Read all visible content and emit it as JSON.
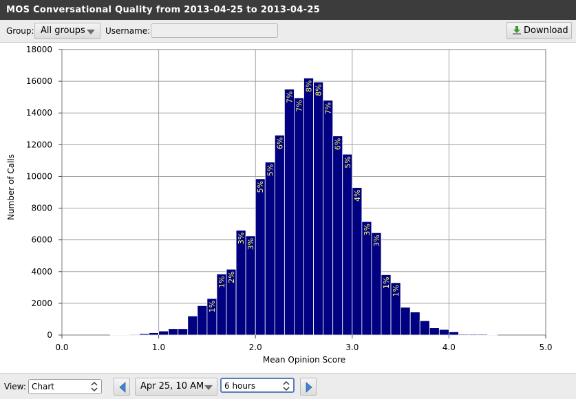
{
  "window": {
    "title": "MOS Conversational Quality from 2013-04-25 to 2013-04-25"
  },
  "toolbar": {
    "group_label": "Group:",
    "group_value": "All groups",
    "username_label": "Username:",
    "username_value": "",
    "download_label": "Download"
  },
  "bottombar": {
    "view_label": "View:",
    "view_value": "Chart",
    "date_value": "Apr 25, 10 AM",
    "range_value": "6 hours"
  },
  "colors": {
    "bar": "#000080",
    "bar_label": "#ffff66",
    "grid": "#a0a0a0"
  },
  "chart_data": {
    "type": "bar",
    "title": "",
    "xlabel": "Mean Opinion Score",
    "ylabel": "Number of Calls",
    "xlim": [
      0,
      5
    ],
    "ylim": [
      0,
      18000
    ],
    "x_ticks": [
      "0.0",
      "1.0",
      "2.0",
      "3.0",
      "4.0",
      "5.0"
    ],
    "y_ticks": [
      "0",
      "2000",
      "4000",
      "6000",
      "8000",
      "10000",
      "12000",
      "14000",
      "16000",
      "18000"
    ],
    "grid": true,
    "bin_width": 0.1,
    "bin_starts": [
      0.5,
      0.6,
      0.7,
      0.8,
      0.9,
      1.0,
      1.1,
      1.2,
      1.3,
      1.4,
      1.5,
      1.6,
      1.7,
      1.8,
      1.9,
      2.0,
      2.1,
      2.2,
      2.3,
      2.4,
      2.5,
      2.6,
      2.7,
      2.8,
      2.9,
      3.0,
      3.1,
      3.2,
      3.3,
      3.4,
      3.5,
      3.6,
      3.7,
      3.8,
      3.9,
      4.0,
      4.1,
      4.2,
      4.3,
      4.4
    ],
    "values": [
      20,
      20,
      40,
      80,
      150,
      250,
      400,
      400,
      1200,
      1850,
      2300,
      3850,
      4150,
      6600,
      6250,
      9850,
      10900,
      12600,
      15500,
      14950,
      16200,
      15950,
      14800,
      12550,
      11400,
      9300,
      7150,
      6450,
      3800,
      3300,
      1750,
      1450,
      900,
      450,
      350,
      200,
      50,
      50,
      50,
      20
    ],
    "bar_labels": [
      "",
      "",
      "",
      "",
      "",
      "",
      "",
      "",
      "",
      "",
      "1%",
      "1%",
      "2%",
      "3%",
      "3%",
      "5%",
      "5%",
      "6%",
      "7%",
      "7%",
      "8%",
      "8%",
      "7%",
      "6%",
      "5%",
      "4%",
      "3%",
      "3%",
      "1%",
      "1%",
      "",
      "",
      "",
      "",
      "",
      "",
      "",
      "",
      "",
      ""
    ]
  }
}
